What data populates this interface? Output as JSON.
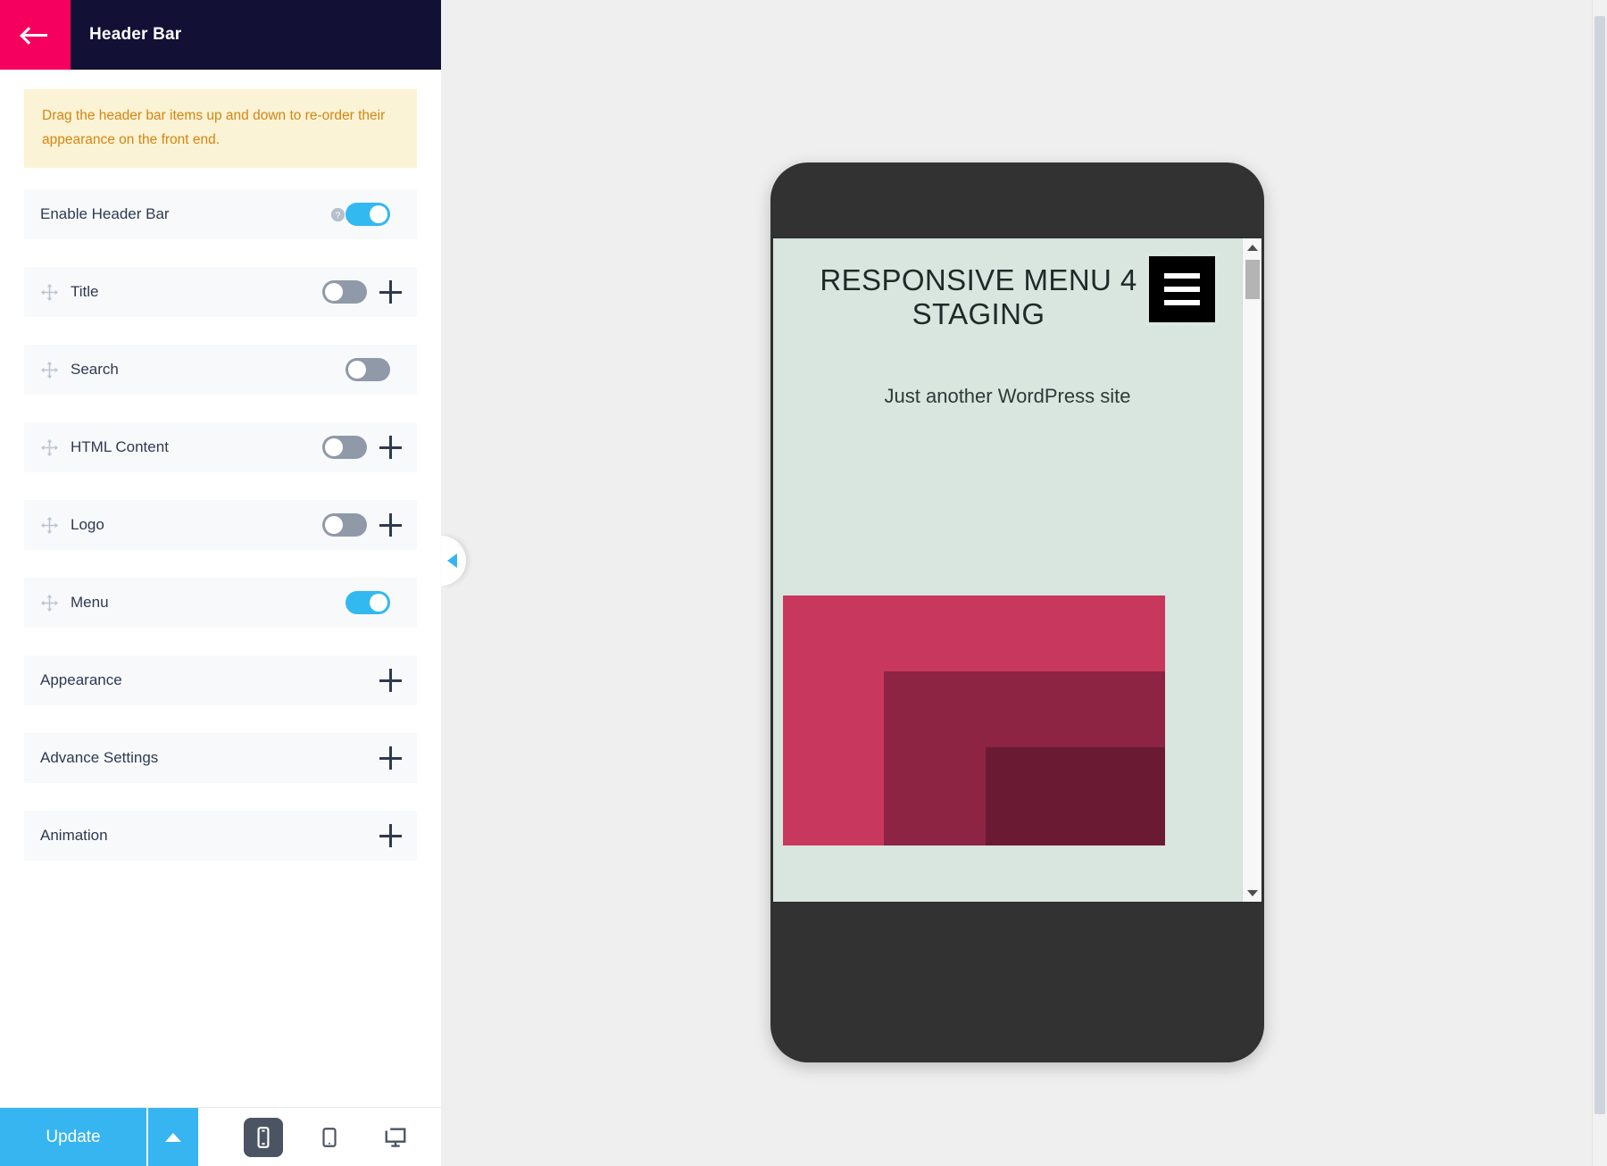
{
  "panel": {
    "title": "Header Bar",
    "back_icon": "arrow-left-icon",
    "notice": "Drag the header bar items up and down to re-order their appearance on the front end."
  },
  "settings": {
    "rows": [
      {
        "label": "Enable Header Bar",
        "draggable": false,
        "has_help": true,
        "toggle": "on",
        "has_plus": false
      },
      {
        "label": "Title",
        "draggable": true,
        "has_help": false,
        "toggle": "off",
        "has_plus": true
      },
      {
        "label": "Search",
        "draggable": true,
        "has_help": false,
        "toggle": "off",
        "has_plus": false
      },
      {
        "label": "HTML Content",
        "draggable": true,
        "has_help": false,
        "toggle": "off",
        "has_plus": true
      },
      {
        "label": "Logo",
        "draggable": true,
        "has_help": false,
        "toggle": "off",
        "has_plus": true
      },
      {
        "label": "Menu",
        "draggable": true,
        "has_help": false,
        "toggle": "on",
        "has_plus": false
      },
      {
        "label": "Appearance",
        "draggable": false,
        "has_help": false,
        "toggle": null,
        "has_plus": true
      },
      {
        "label": "Advance Settings",
        "draggable": false,
        "has_help": false,
        "toggle": null,
        "has_plus": true
      },
      {
        "label": "Animation",
        "draggable": false,
        "has_help": false,
        "toggle": null,
        "has_plus": true
      }
    ]
  },
  "bottom_bar": {
    "update_label": "Update",
    "caret_icon": "caret-up-icon",
    "devices": [
      {
        "name": "mobile",
        "icon": "mobile-icon",
        "active": true
      },
      {
        "name": "tablet",
        "icon": "tablet-icon",
        "active": false
      },
      {
        "name": "desktop",
        "icon": "desktop-icon",
        "active": false
      }
    ]
  },
  "collapse_tab": {
    "icon": "triangle-left-icon"
  },
  "preview": {
    "device": "mobile",
    "site_title": "RESPONSIVE MENU 4 STAGING",
    "site_tagline": "Just another WordPress site",
    "menu_button_icon": "hamburger-icon",
    "background_color": "#d9e5df",
    "blocks": [
      {
        "color": "#c8385e"
      },
      {
        "color": "#8d2444"
      },
      {
        "color": "#6b1a33"
      }
    ]
  },
  "colors": {
    "accent_pink": "#f5005e",
    "header_navy": "#131035",
    "toggle_on": "#32b9ef",
    "toggle_off": "#8f99a8",
    "update_blue": "#36b5f0",
    "notice_bg": "#fbf3d5",
    "notice_text": "#d58512"
  }
}
